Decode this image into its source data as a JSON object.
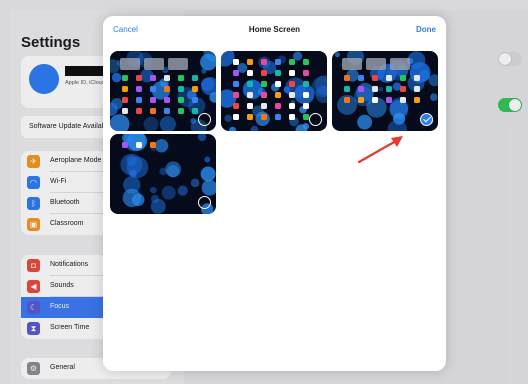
{
  "settings": {
    "title": "Settings",
    "profile_subtitle": "Apple ID, iCloud, Media",
    "software_update": "Software Update Available",
    "group1": [
      {
        "label": "Aeroplane Mode",
        "icon": "airplane-icon",
        "color": "#f59a23"
      },
      {
        "label": "Wi-Fi",
        "icon": "wifi-icon",
        "color": "#2f7df6"
      },
      {
        "label": "Bluetooth",
        "icon": "bluetooth-icon",
        "color": "#2f7df6"
      },
      {
        "label": "Classroom",
        "icon": "classroom-icon",
        "color": "#f59a23"
      }
    ],
    "group2": [
      {
        "label": "Notifications",
        "icon": "bell-icon",
        "color": "#eb4d3d"
      },
      {
        "label": "Sounds",
        "icon": "speaker-icon",
        "color": "#eb4d3d"
      },
      {
        "label": "Focus",
        "icon": "moon-icon",
        "color": "#5b5bd6",
        "selected": true
      },
      {
        "label": "Screen Time",
        "icon": "hourglass-icon",
        "color": "#5b5bd6"
      }
    ],
    "group3": [
      {
        "label": "General",
        "icon": "gear-icon",
        "color": "#8e8e93"
      }
    ]
  },
  "sheet": {
    "cancel_label": "Cancel",
    "title": "Home Screen",
    "done_label": "Done",
    "pages": [
      {
        "name": "home-page-1",
        "selected": false
      },
      {
        "name": "home-page-2",
        "selected": false
      },
      {
        "name": "home-page-3",
        "selected": true
      },
      {
        "name": "home-page-4",
        "selected": false
      }
    ]
  },
  "colors": {
    "accent": "#2f7df6",
    "toggle_on": "#34c759",
    "arrow": "#e8392c"
  }
}
